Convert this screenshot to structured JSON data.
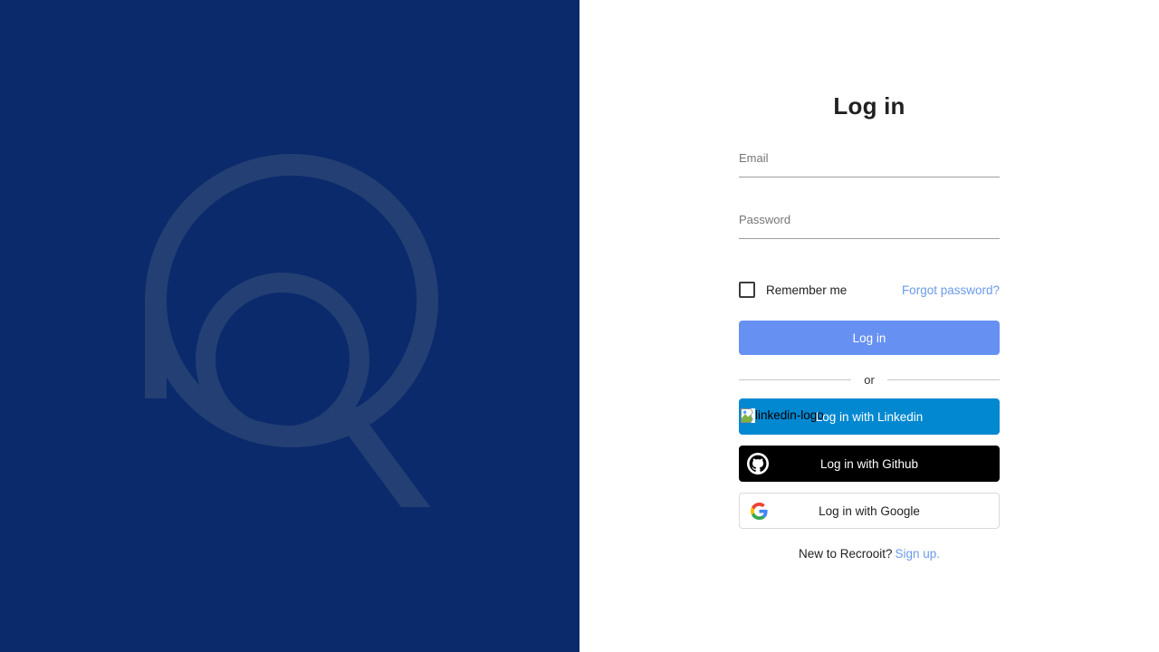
{
  "brand": {
    "logo_icon": "recrooit-magnifier-logo",
    "background_color": "#0a2a6b",
    "logo_color": "#243f73"
  },
  "login": {
    "title": "Log in",
    "email": {
      "placeholder": "Email",
      "value": ""
    },
    "password": {
      "placeholder": "Password",
      "value": ""
    },
    "remember_label": "Remember me",
    "remember_checked": false,
    "forgot_label": "Forgot password?",
    "submit_label": "Log in",
    "divider_label": "or",
    "social": [
      {
        "label": "Log in with Linkedin",
        "icon": "broken-image-icon",
        "alt_text": "linkedin-logo",
        "color": "#0288d1"
      },
      {
        "label": "Log in with Github",
        "icon": "github-icon",
        "color": "#000000"
      },
      {
        "label": "Log in with Google",
        "icon": "google-icon",
        "color": "#ffffff"
      }
    ],
    "signup_prompt": "New to Recrooit?",
    "signup_label": "Sign up.",
    "accent_color": "#6690f2",
    "link_color": "#6b9ae8"
  }
}
